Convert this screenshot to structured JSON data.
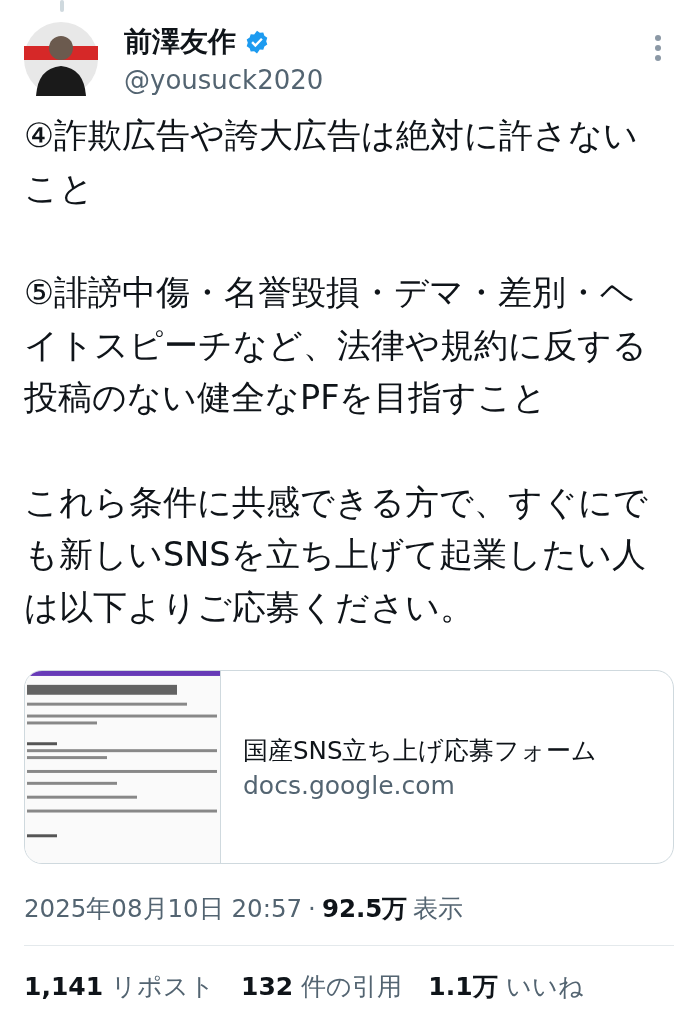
{
  "author": {
    "name": "前澤友作",
    "verified": true,
    "handle": "@yousuck2020"
  },
  "body": [
    "④詐欺広告や誇大広告は絶対に許さないこと",
    "⑤誹謗中傷・名誉毀損・デマ・差別・ヘイトスピーチなど、法律や規約に反する投稿のない健全なPFを目指すこと",
    "これら条件に共感できる方で、すぐにでも新しいSNSを立ち上げて起業したい人は以下よりご応募ください。"
  ],
  "link_card": {
    "title": "国産SNS立ち上げ応募フォーム",
    "domain": "docs.google.com"
  },
  "meta": {
    "date": "2025年08月10日 20:57",
    "separator": "·",
    "views_count": "92.5万",
    "views_label": "表示"
  },
  "stats": [
    {
      "count": "1,141",
      "label": "リポスト"
    },
    {
      "count": "132",
      "label": "件の引用"
    },
    {
      "count": "1.1万",
      "label": "いいね"
    }
  ]
}
